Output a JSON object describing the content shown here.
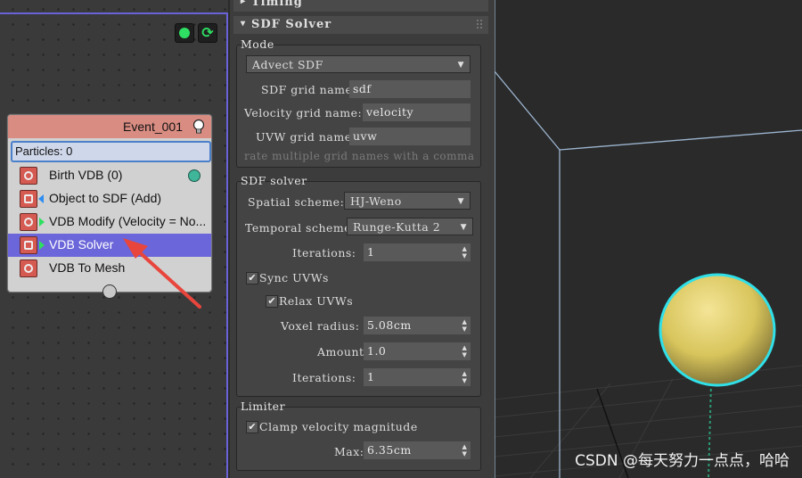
{
  "particle_view": {
    "event": {
      "title": "Event_001",
      "particles_label": "Particles: 0",
      "operators": [
        {
          "label": "Birth VDB (0)"
        },
        {
          "label": "Object to SDF (Add)"
        },
        {
          "label": "VDB Modify (Velocity = No..."
        },
        {
          "label": "VDB Solver"
        },
        {
          "label": "VDB To Mesh"
        }
      ]
    }
  },
  "panel": {
    "timing_rollout": "Timing",
    "sdf_rollout": "SDF Solver",
    "mode": {
      "title": "Mode",
      "dropdown_value": "Advect SDF",
      "sdf_grid_label": "SDF grid name:",
      "sdf_grid_value": "sdf",
      "velocity_grid_label": "Velocity grid name:",
      "velocity_grid_value": "velocity",
      "uvw_grid_label": "UVW grid names:",
      "uvw_grid_value": "uvw",
      "hint": "rate multiple grid names with a comma"
    },
    "sdf_solver": {
      "title": "SDF solver",
      "spatial_label": "Spatial scheme:",
      "spatial_value": "HJ-Weno",
      "temporal_label": "Temporal scheme:",
      "temporal_value": "Runge-Kutta 2",
      "iterations_label": "Iterations:",
      "iterations_value": "1",
      "sync_uvws": "Sync UVWs",
      "relax_uvws": "Relax UVWs",
      "voxel_radius_label": "Voxel radius:",
      "voxel_radius_value": "5.08cm",
      "amount_label": "Amount:",
      "amount_value": "1.0",
      "iterations2_label": "Iterations:",
      "iterations2_value": "1"
    },
    "limiter": {
      "title": "Limiter",
      "clamp_label": "Clamp velocity magnitude",
      "max_label": "Max:",
      "max_value": "6.35cm"
    }
  },
  "viewport": {
    "watermark": "CSDN @每天努力一点点，哈哈"
  },
  "colors": {
    "selection": "#6b66d9",
    "event_header": "#d98c82",
    "accent_green": "#2edf63",
    "sphere": "#e0cf63",
    "sphere_outline": "#30e0e8",
    "annotation_arrow": "#e8453c"
  }
}
